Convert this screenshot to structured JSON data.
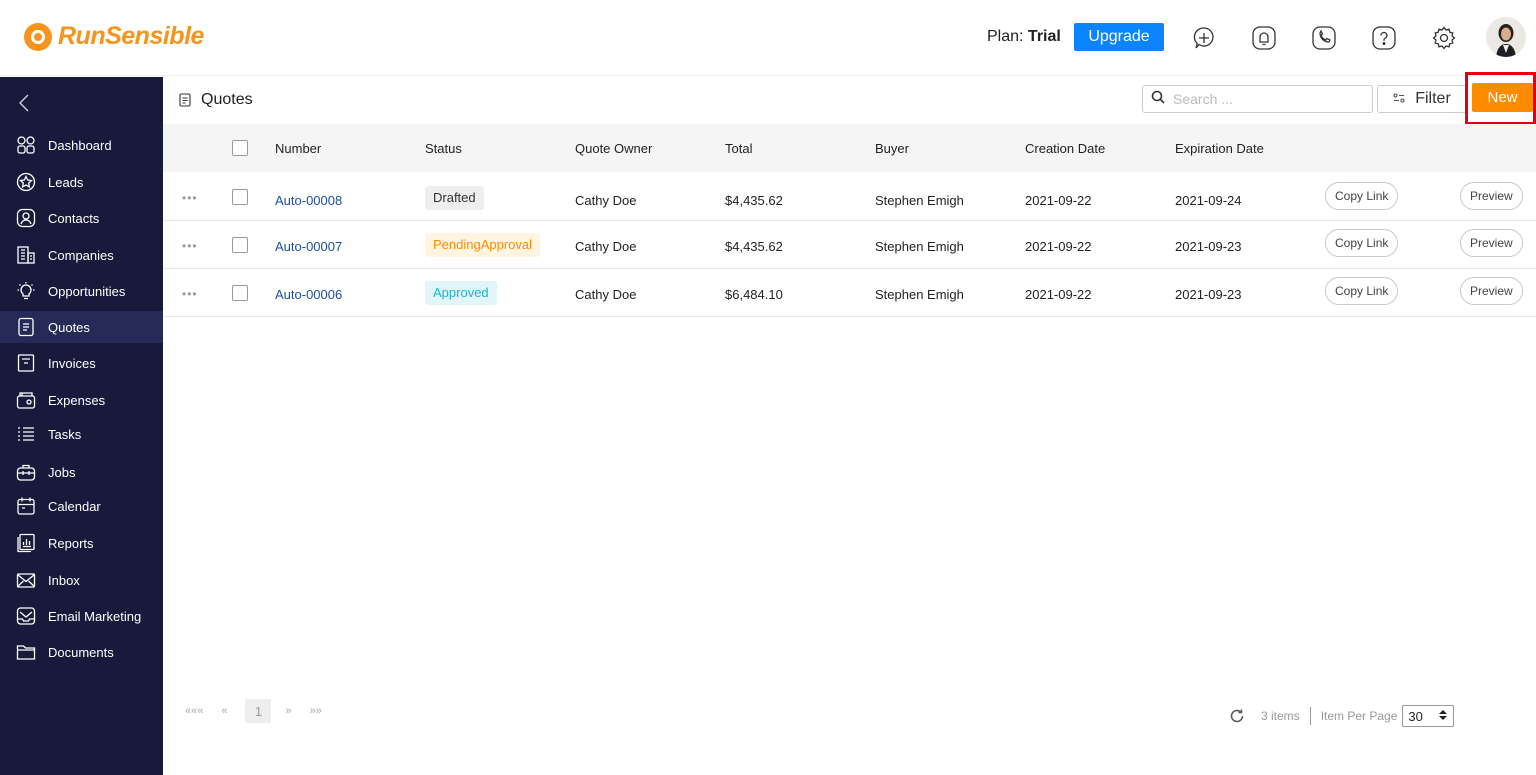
{
  "header": {
    "logo_text": "RunSensible",
    "plan_label": "Plan:",
    "plan_value": "Trial",
    "upgrade_label": "Upgrade",
    "icons": [
      "add-task-icon",
      "bell-icon",
      "phone-icon",
      "help-icon",
      "gear-icon",
      "avatar"
    ],
    "brand_color": "#f7941d",
    "accent_color": "#0a84ff"
  },
  "sidebar": {
    "collapse_icon": "chevron-left-icon",
    "items": [
      {
        "label": "Dashboard",
        "icon": "dashboard-icon"
      },
      {
        "label": "Leads",
        "icon": "leads-icon"
      },
      {
        "label": "Contacts",
        "icon": "contacts-icon"
      },
      {
        "label": "Companies",
        "icon": "companies-icon"
      },
      {
        "label": "Opportunities",
        "icon": "opportunities-icon"
      },
      {
        "label": "Quotes",
        "icon": "quotes-icon",
        "active": true
      },
      {
        "label": "Invoices",
        "icon": "invoices-icon"
      },
      {
        "label": "Expenses",
        "icon": "expenses-icon"
      },
      {
        "label": "Tasks",
        "icon": "tasks-icon"
      },
      {
        "label": "Jobs",
        "icon": "jobs-icon"
      },
      {
        "label": "Calendar",
        "icon": "calendar-icon"
      },
      {
        "label": "Reports",
        "icon": "reports-icon"
      },
      {
        "label": "Inbox",
        "icon": "inbox-icon"
      },
      {
        "label": "Email Marketing",
        "icon": "email-marketing-icon"
      },
      {
        "label": "Documents",
        "icon": "documents-icon"
      }
    ],
    "bg_color": "#171a3b"
  },
  "main": {
    "title": "Quotes",
    "search_placeholder": "Search ...",
    "filter_label": "Filter",
    "new_label": "New",
    "new_color": "#ff8c00",
    "columns": [
      "Number",
      "Status",
      "Quote Owner",
      "Total",
      "Buyer",
      "Creation Date",
      "Expiration Date"
    ],
    "rows": [
      {
        "number": "Auto-00008",
        "status": "Drafted",
        "owner": "Cathy Doe",
        "total": "$4,435.62",
        "buyer": "Stephen Emigh",
        "created": "2021-09-22",
        "expires": "2021-09-24",
        "copy": "Copy Link",
        "preview": "Preview"
      },
      {
        "number": "Auto-00007",
        "status": "PendingApproval",
        "owner": "Cathy Doe",
        "total": "$4,435.62",
        "buyer": "Stephen Emigh",
        "created": "2021-09-22",
        "expires": "2021-09-23",
        "copy": "Copy Link",
        "preview": "Preview"
      },
      {
        "number": "Auto-00006",
        "status": "Approved",
        "owner": "Cathy Doe",
        "total": "$6,484.10",
        "buyer": "Stephen Emigh",
        "created": "2021-09-22",
        "expires": "2021-09-23",
        "copy": "Copy Link",
        "preview": "Preview"
      }
    ],
    "row_menu": "•••"
  },
  "pager": {
    "first": "«««",
    "prev": "«",
    "current": "1",
    "next": "»",
    "last": "»»",
    "items_count": "3 items",
    "per_page_label": "Item Per Page",
    "per_page_value": "30"
  }
}
